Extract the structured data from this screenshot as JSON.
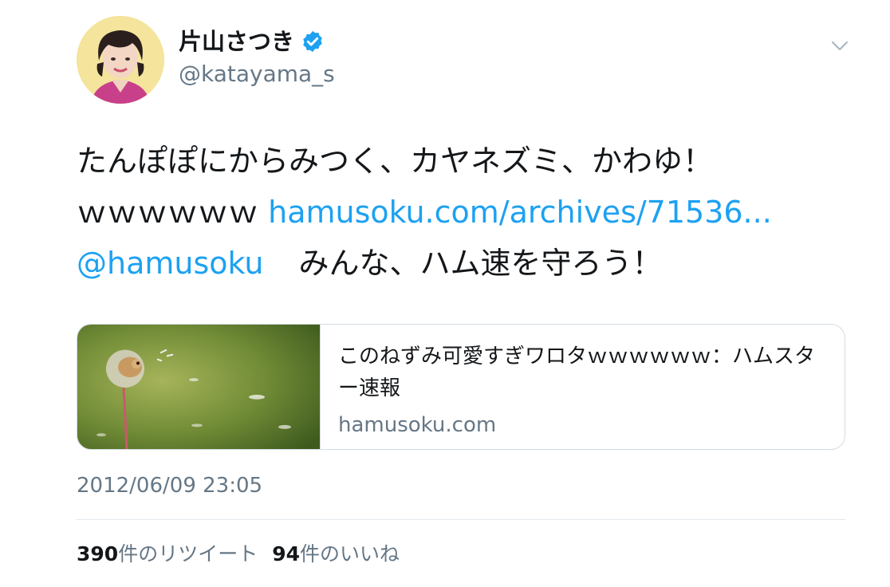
{
  "user": {
    "display_name": "片山さつき",
    "handle": "@katayama_s",
    "verified": true
  },
  "tweet": {
    "line1": "たんぽぽにからみつく、カヤネズミ、かわゆ！",
    "line2_text": "ｗｗｗｗｗｗ",
    "line2_link": "hamusoku.com/archives/71536...",
    "line3_mention": "@hamusoku",
    "line3_text": "みんな、ハム速を守ろう！"
  },
  "card": {
    "title": "このねずみ可愛すぎワロタｗｗｗｗｗｗ：ハムスター速報",
    "domain": "hamusoku.com"
  },
  "timestamp": "2012/06/09 23:05",
  "stats": {
    "retweet_count": "390",
    "retweet_label": "件のリツイート",
    "like_count": "94",
    "like_label": "件のいいね"
  },
  "icons": {
    "verified": "verified-badge-icon",
    "caret": "chevron-down-icon"
  },
  "colors": {
    "link": "#1da1f2",
    "secondary_text": "#657786",
    "primary_text": "#14171a"
  }
}
